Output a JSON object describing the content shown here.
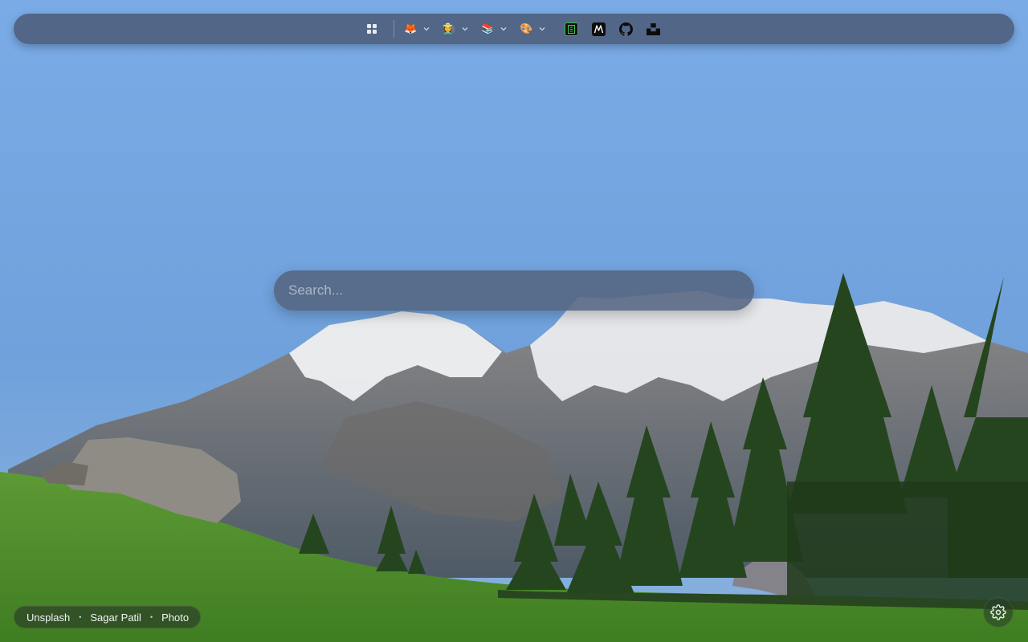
{
  "wallpaper": {
    "description_icon": "mountain-landscape-photo",
    "colors": {
      "sky_top": "#7aa9e3",
      "sky_bottom": "#6c9bd3",
      "grass": "#4d8a2a",
      "trees": "#24441f"
    }
  },
  "topbar": {
    "apps_icon": "grid-icon",
    "folders": [
      {
        "emoji": "🦊",
        "icon": "fox-emoji-folder"
      },
      {
        "emoji": "👩‍🌾",
        "icon": "person-emoji-folder"
      },
      {
        "emoji": "📚",
        "icon": "books-emoji-folder"
      },
      {
        "emoji": "🎨",
        "icon": "palette-emoji-folder"
      }
    ],
    "links": [
      {
        "icon": "terminal-site-icon"
      },
      {
        "icon": "m-logo-icon"
      },
      {
        "icon": "github-icon"
      },
      {
        "icon": "unsplash-icon"
      }
    ]
  },
  "search": {
    "placeholder": "Search..."
  },
  "credit": {
    "source": "Unsplash",
    "author": "Sagar Patil",
    "link": "Photo",
    "separator": "•"
  },
  "settings": {
    "icon": "gear-icon"
  }
}
